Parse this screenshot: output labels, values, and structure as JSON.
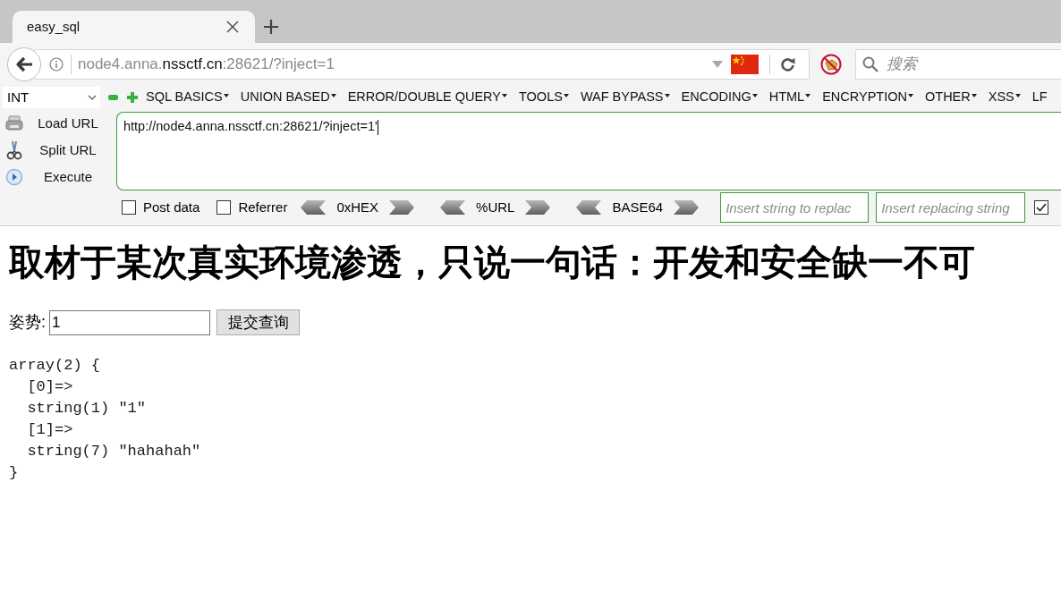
{
  "tabs": [
    {
      "title": "easy_sql",
      "selected": true
    }
  ],
  "address_bar": {
    "url_start": "node4.anna.",
    "url_host": "nssctf.cn",
    "url_end": ":28621/?inject=1"
  },
  "search": {
    "placeholder": "搜索"
  },
  "hackbar": {
    "select": {
      "value": "INT"
    },
    "menus": [
      {
        "label": "SQL BASICS",
        "caret": true
      },
      {
        "label": "UNION BASED",
        "caret": true
      },
      {
        "label": "ERROR/DOUBLE QUERY",
        "caret": true
      },
      {
        "label": "TOOLS",
        "caret": true
      },
      {
        "label": "WAF BYPASS",
        "caret": true
      },
      {
        "label": "ENCODING",
        "caret": true
      },
      {
        "label": "HTML",
        "caret": true
      },
      {
        "label": "ENCRYPTION",
        "caret": true
      },
      {
        "label": "OTHER",
        "caret": true
      },
      {
        "label": "XSS",
        "caret": true
      },
      {
        "label": "LF",
        "caret": false
      }
    ],
    "actions": [
      {
        "kind": "load",
        "label": "Load URL"
      },
      {
        "kind": "split",
        "label": "Split URL"
      },
      {
        "kind": "execute",
        "label": "Execute"
      }
    ],
    "url_input": {
      "value": "http://node4.anna.nssctf.cn:28621/?inject=1'"
    },
    "options": [
      {
        "label": "Post data",
        "checked": false
      },
      {
        "label": "Referrer",
        "checked": false
      }
    ],
    "encoders": [
      {
        "label": "0xHEX"
      },
      {
        "label": "%URL"
      },
      {
        "label": "BASE64"
      }
    ],
    "replace_fields": [
      {
        "placeholder": "Insert string to replac"
      },
      {
        "placeholder": "Insert replacing string"
      }
    ],
    "replace_toggle": {
      "checked": true
    }
  },
  "page": {
    "heading": "取材于某次真实环境渗透，只说一句话：开发和安全缺一不可",
    "form": {
      "label": "姿势:",
      "value": "1",
      "button": "提交查询"
    },
    "output": "array(2) {\n  [0]=>\n  string(1) \"1\"\n  [1]=>\n  string(7) \"hahahah\"\n}"
  }
}
